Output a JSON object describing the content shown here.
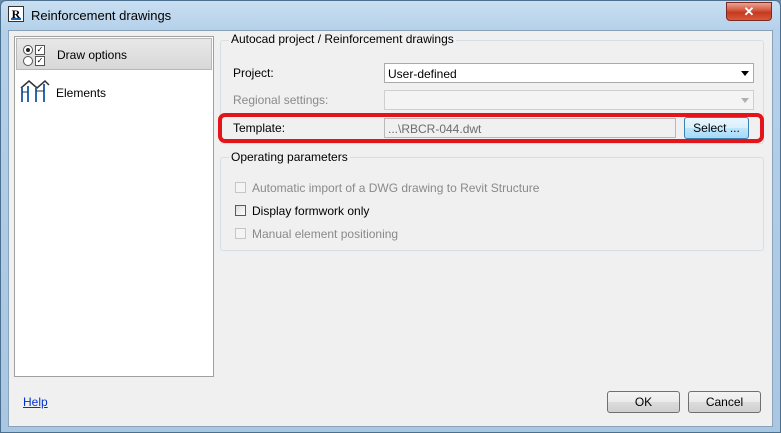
{
  "window": {
    "title": "Reinforcement drawings",
    "app_icon_letter": "R",
    "close_glyph": "✕"
  },
  "nav": {
    "items": [
      {
        "label": "Draw options",
        "icon": "draw-options-icon"
      },
      {
        "label": "Elements",
        "icon": "frame-structure-icon"
      }
    ]
  },
  "autocad_group": {
    "title": "Autocad project / Reinforcement drawings",
    "project_label": "Project:",
    "project_value": "User-defined",
    "regional_label": "Regional settings:",
    "regional_value": "",
    "template_label": "Template:",
    "template_value": "...\\RBCR-044.dwt",
    "select_label": "Select ..."
  },
  "operating_group": {
    "title": "Operating parameters",
    "options": [
      {
        "label": "Automatic import of a DWG drawing to Revit Structure",
        "checked": false,
        "enabled": false
      },
      {
        "label": "Display formwork only",
        "checked": false,
        "enabled": true
      },
      {
        "label": "Manual element positioning",
        "checked": false,
        "enabled": false
      }
    ]
  },
  "footer": {
    "help_label": "Help",
    "ok_label": "OK",
    "cancel_label": "Cancel"
  },
  "colors": {
    "highlight": "#e4141b",
    "link": "#0033cc",
    "close": "#c4391f"
  }
}
